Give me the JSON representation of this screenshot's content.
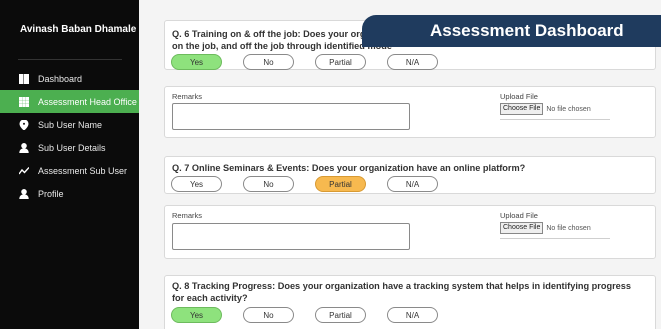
{
  "sidebar": {
    "user_name": "Avinash Baban Dhamale",
    "items": [
      {
        "label": "Dashboard",
        "icon": "grid-icon"
      },
      {
        "label": "Assessment Head Office",
        "icon": "apps-icon"
      },
      {
        "label": "Sub User Name",
        "icon": "location-pin-icon"
      },
      {
        "label": "Sub User Details",
        "icon": "person-icon"
      },
      {
        "label": "Assessment Sub User",
        "icon": "trend-icon"
      },
      {
        "label": "Profile",
        "icon": "person-icon"
      }
    ],
    "active_color": "#4caf50"
  },
  "banner": {
    "title": "Assessment Dashboard",
    "color": "#1f3b5e"
  },
  "options": {
    "yes": "Yes",
    "no": "No",
    "partial": "Partial",
    "na": "N/A"
  },
  "form": {
    "remarks_label": "Remarks",
    "upload_label": "Upload File",
    "choose_file": "Choose File",
    "no_file": "No file chosen"
  },
  "questions": [
    {
      "text": "Q. 6 Training on & off the job: Does your organiza",
      "text2": "on the job, and off the job through identified mode",
      "selected": "Yes"
    },
    {
      "text": "Q. 7 Online Seminars & Events: Does your organization have an online platform?",
      "selected": "Partial"
    },
    {
      "text": "Q. 8 Tracking Progress: Does your organization have a tracking system that helps in identifying progress",
      "text2": "for each activity?",
      "selected": "Yes"
    }
  ],
  "colors": {
    "selected_yes": "#8ee27d",
    "selected_partial": "#f7b94f"
  }
}
